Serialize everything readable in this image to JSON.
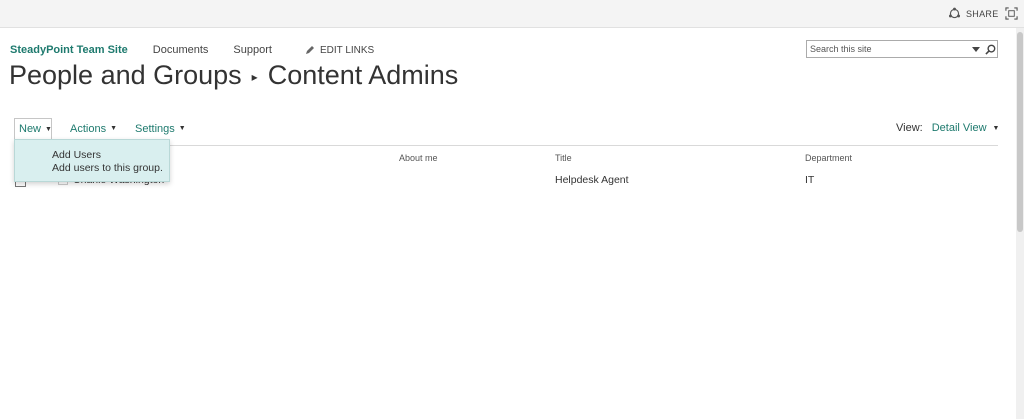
{
  "suite_bar": {
    "share_label": "SHARE"
  },
  "top_nav": {
    "site_title": "SteadyPoint Team Site",
    "links": [
      "Documents",
      "Support"
    ],
    "edit_links_label": "EDIT LINKS"
  },
  "search": {
    "placeholder": "Search this site",
    "value": ""
  },
  "page_title": {
    "parent": "People and Groups",
    "current": "Content Admins"
  },
  "toolbar": {
    "new_label": "New",
    "actions_label": "Actions",
    "settings_label": "Settings",
    "view_label": "View:",
    "view_value": "Detail View"
  },
  "new_menu": {
    "items": [
      {
        "title": "Add Users",
        "description": "Add users to this group."
      }
    ]
  },
  "table": {
    "columns": [
      "About me",
      "Title",
      "Department"
    ],
    "rows": [
      {
        "name": "Charlie Washington",
        "about_me": "",
        "title": "Helpdesk Agent",
        "department": "IT"
      }
    ]
  },
  "colors": {
    "accent": "#1e7a6e",
    "menu_background": "#d9efef"
  }
}
